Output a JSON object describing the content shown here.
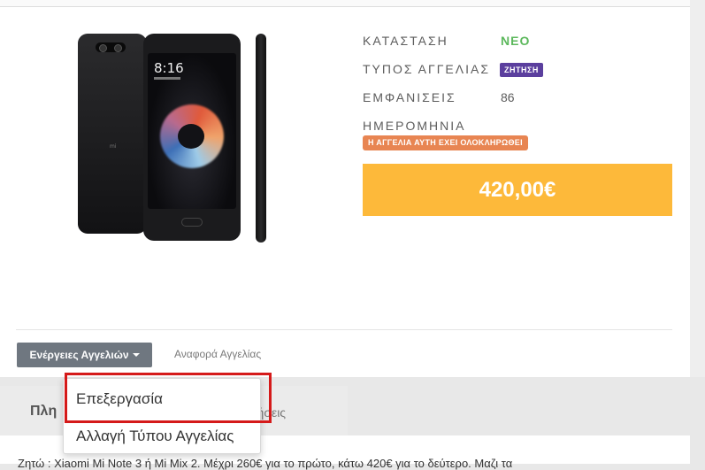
{
  "listing": {
    "condition_label": "ΚΑΤΑΣΤΑΣΗ",
    "condition_value": "ΝΕΟ",
    "type_label": "ΤΥΠΟΣ ΑΓΓΕΛΙΑΣ",
    "type_badge": "ΖΗΤΗΣΗ",
    "views_label": "ΕΜΦΑΝΙΣΕΙΣ",
    "views_value": "86",
    "date_label": "ΗΜΕΡΟΜΗΝΙΑ",
    "completed_badge": "Η ΑΓΓΕΛΙΑ ΑΥΤΗ ΕΧΕΙ ΟΛΟΚΛΗΡΩΘΕΙ",
    "price": "420,00€"
  },
  "phone_screen": {
    "clock": "8:16"
  },
  "actions": {
    "button_label": "Ενέργειες Αγγελιών",
    "report_link": "Αναφορά Αγγελίας"
  },
  "dropdown": {
    "items": [
      "Επεξεργασία",
      "Αλλαγή Τύπου Αγγελίας"
    ]
  },
  "tabs": {
    "left_label": "Πλη",
    "right_label": "τήσεις"
  },
  "description": {
    "text": "Ζητώ : Xiaomi Mi Note 3 ή Mi Mix 2. Μέχρι 260€ για το πρώτο, κάτω 420€ για το δεύτερο. Μαζι τα"
  },
  "colors": {
    "condition_new": "#5cb85c",
    "type_badge": "#5b3f9e",
    "completed_badge": "#e88552",
    "price_box": "#fdb93a",
    "actions_button": "#6f7780",
    "highlight": "#d51a1a"
  }
}
